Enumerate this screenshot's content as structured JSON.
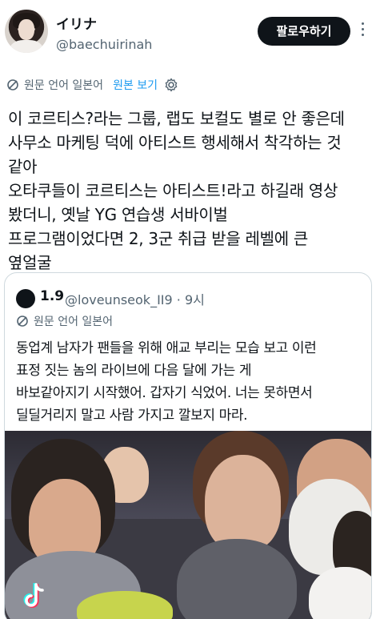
{
  "user": {
    "display_name": "イリナ",
    "handle": "@baechuirinah",
    "follow_label": "팔로우하기"
  },
  "translate": {
    "source_language": "원문 언어 일본어",
    "show_original": "원본 보기"
  },
  "tweet": {
    "lines": [
      "이 코르티스?라는 그룹, 랩도 보컬도 별로 안 좋은데",
      "사무소 마케팅 덕에 아티스트 행세해서 착각하는 것",
      "같아",
      "오타쿠들이 코르티스는 아티스트!라고 하길래 영상",
      "봤더니, 옛날 YG 연습생 서바이벌",
      "프로그램이었다면 2, 3군 취급 받을 레벨에 큰",
      "옆얼굴"
    ]
  },
  "quote": {
    "display_name": "1.9",
    "handle_time": "@loveunseok_II9 · 9시",
    "source_language": "원문 언어 일본어",
    "lines": [
      "동업계 남자가 팬들을 위해 애교 부리는 모습 보고 이런",
      "표정 짓는 놈의 라이브에 다음 달에 가는 게",
      "바보같아지기 시작했어. 갑자기 식었어. 너는 못하면서",
      "딜딜거리지 말고 사람 가지고 깔보지 마라."
    ]
  },
  "colors": {
    "text": "#0f1419",
    "secondary": "#536471",
    "accent": "#1d9bf0",
    "border": "#cfd9de"
  }
}
